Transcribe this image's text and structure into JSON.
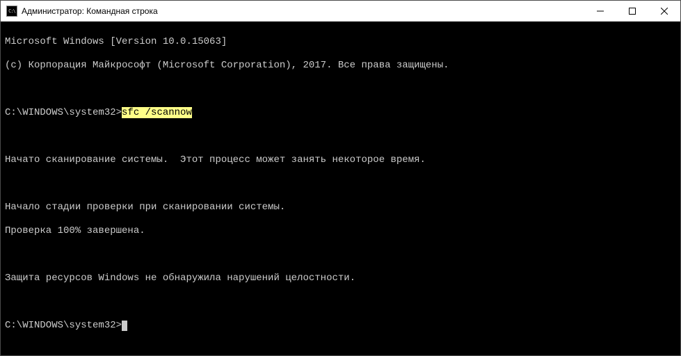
{
  "titlebar": {
    "icon_text": "C:\\",
    "title": "Администратор: Командная строка"
  },
  "console": {
    "line1": "Microsoft Windows [Version 10.0.15063]",
    "line2": "(c) Корпорация Майкрософт (Microsoft Corporation), 2017. Все права защищены.",
    "prompt1": "C:\\WINDOWS\\system32>",
    "command1": "sfc /scannow",
    "line4": "Начато сканирование системы.  Этот процесс может занять некоторое время.",
    "line5": "Начало стадии проверки при сканировании системы.",
    "line6": "Проверка 100% завершена.",
    "line7": "Защита ресурсов Windows не обнаружила нарушений целостности.",
    "prompt2": "C:\\WINDOWS\\system32>"
  }
}
